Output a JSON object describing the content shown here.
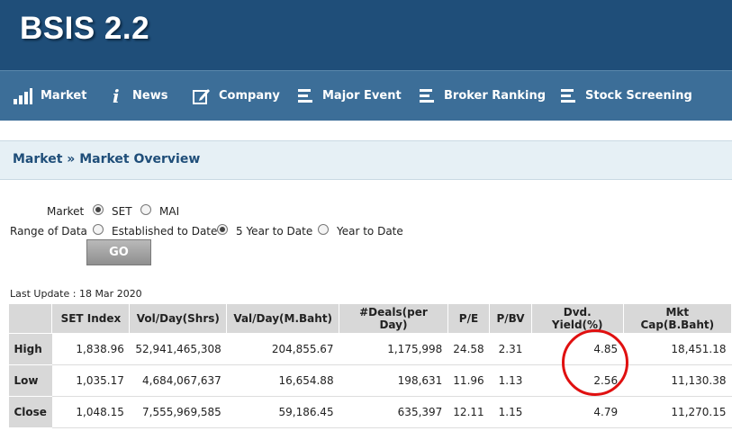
{
  "app": {
    "title": "BSIS 2.2"
  },
  "nav": [
    {
      "label": "Market",
      "icon": "bar-chart-icon"
    },
    {
      "label": "News",
      "icon": "info-icon"
    },
    {
      "label": "Company",
      "icon": "edit-icon"
    },
    {
      "label": "Major Event",
      "icon": "list-icon"
    },
    {
      "label": "Broker Ranking",
      "icon": "list-icon"
    },
    {
      "label": "Stock Screening",
      "icon": "list-icon"
    }
  ],
  "breadcrumb": "Market » Market Overview",
  "form": {
    "market_label": "Market",
    "market_options": [
      "SET",
      "MAI"
    ],
    "market_selected": "SET",
    "range_label": "Range of Data",
    "range_options": [
      "Established to Date",
      "5 Year to Date",
      "Year to Date"
    ],
    "range_selected": "5 Year to Date",
    "go_label": "GO"
  },
  "last_update": "Last Update : 18 Mar 2020",
  "table": {
    "headers": [
      "",
      "SET Index",
      "Vol/Day(Shrs)",
      "Val/Day(M.Baht)",
      "#Deals(per Day)",
      "P/E",
      "P/BV",
      "Dvd. Yield(%)",
      "Mkt Cap(B.Baht)"
    ],
    "rows": [
      [
        "High",
        "1,838.96",
        "52,941,465,308",
        "204,855.67",
        "1,175,998",
        "24.58",
        "2.31",
        "4.85",
        "18,451.18"
      ],
      [
        "Low",
        "1,035.17",
        "4,684,067,637",
        "16,654.88",
        "198,631",
        "11.96",
        "1.13",
        "2.56",
        "11,130.38"
      ],
      [
        "Close",
        "1,048.15",
        "7,555,969,585",
        "59,186.45",
        "635,397",
        "12.11",
        "1.15",
        "4.79",
        "11,270.15"
      ]
    ]
  },
  "colors": {
    "header": "#1f4e79",
    "nav": "#3c6e98",
    "annotation": "#e01010"
  }
}
